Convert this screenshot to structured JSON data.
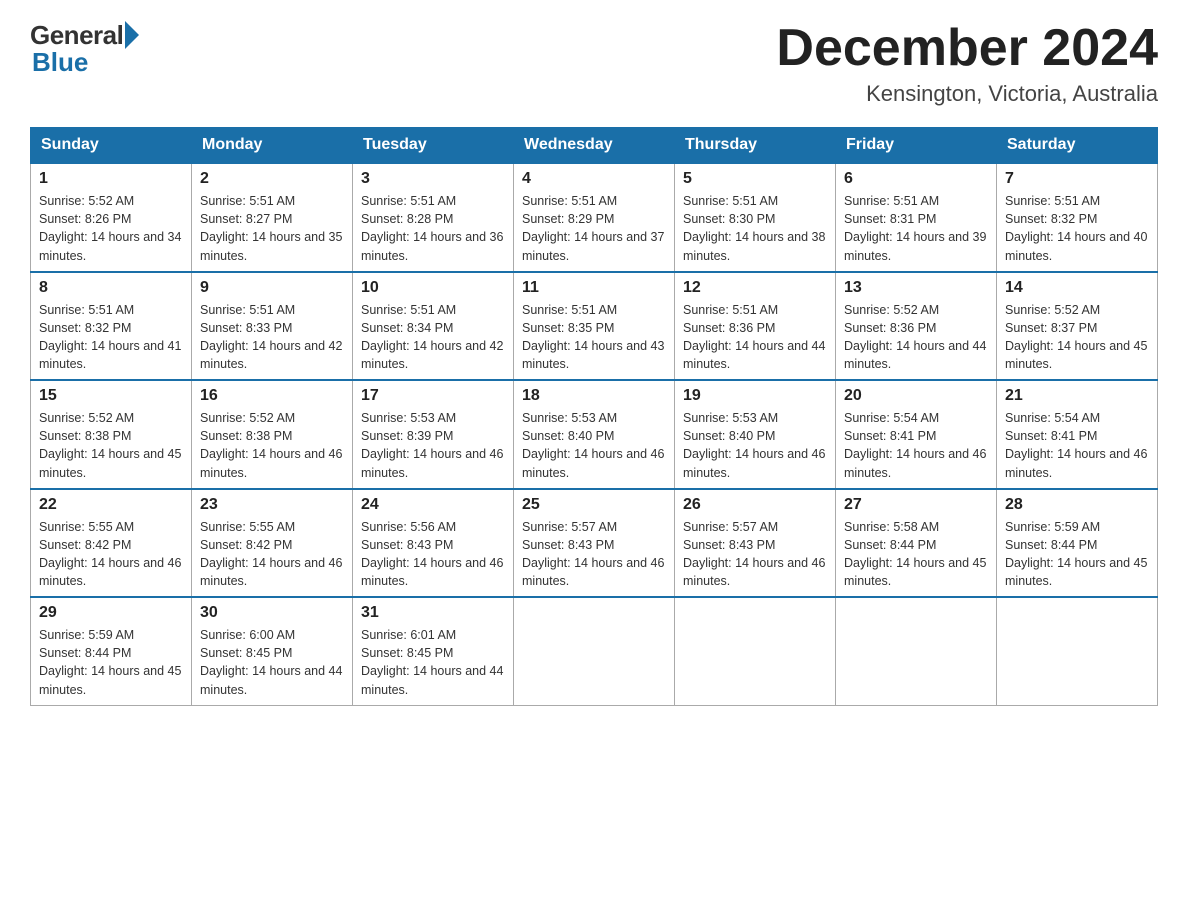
{
  "header": {
    "logo_general": "General",
    "logo_blue": "Blue",
    "month_title": "December 2024",
    "location": "Kensington, Victoria, Australia"
  },
  "days_of_week": [
    "Sunday",
    "Monday",
    "Tuesday",
    "Wednesday",
    "Thursday",
    "Friday",
    "Saturday"
  ],
  "weeks": [
    [
      {
        "day": "1",
        "sunrise": "5:52 AM",
        "sunset": "8:26 PM",
        "daylight": "14 hours and 34 minutes."
      },
      {
        "day": "2",
        "sunrise": "5:51 AM",
        "sunset": "8:27 PM",
        "daylight": "14 hours and 35 minutes."
      },
      {
        "day": "3",
        "sunrise": "5:51 AM",
        "sunset": "8:28 PM",
        "daylight": "14 hours and 36 minutes."
      },
      {
        "day": "4",
        "sunrise": "5:51 AM",
        "sunset": "8:29 PM",
        "daylight": "14 hours and 37 minutes."
      },
      {
        "day": "5",
        "sunrise": "5:51 AM",
        "sunset": "8:30 PM",
        "daylight": "14 hours and 38 minutes."
      },
      {
        "day": "6",
        "sunrise": "5:51 AM",
        "sunset": "8:31 PM",
        "daylight": "14 hours and 39 minutes."
      },
      {
        "day": "7",
        "sunrise": "5:51 AM",
        "sunset": "8:32 PM",
        "daylight": "14 hours and 40 minutes."
      }
    ],
    [
      {
        "day": "8",
        "sunrise": "5:51 AM",
        "sunset": "8:32 PM",
        "daylight": "14 hours and 41 minutes."
      },
      {
        "day": "9",
        "sunrise": "5:51 AM",
        "sunset": "8:33 PM",
        "daylight": "14 hours and 42 minutes."
      },
      {
        "day": "10",
        "sunrise": "5:51 AM",
        "sunset": "8:34 PM",
        "daylight": "14 hours and 42 minutes."
      },
      {
        "day": "11",
        "sunrise": "5:51 AM",
        "sunset": "8:35 PM",
        "daylight": "14 hours and 43 minutes."
      },
      {
        "day": "12",
        "sunrise": "5:51 AM",
        "sunset": "8:36 PM",
        "daylight": "14 hours and 44 minutes."
      },
      {
        "day": "13",
        "sunrise": "5:52 AM",
        "sunset": "8:36 PM",
        "daylight": "14 hours and 44 minutes."
      },
      {
        "day": "14",
        "sunrise": "5:52 AM",
        "sunset": "8:37 PM",
        "daylight": "14 hours and 45 minutes."
      }
    ],
    [
      {
        "day": "15",
        "sunrise": "5:52 AM",
        "sunset": "8:38 PM",
        "daylight": "14 hours and 45 minutes."
      },
      {
        "day": "16",
        "sunrise": "5:52 AM",
        "sunset": "8:38 PM",
        "daylight": "14 hours and 46 minutes."
      },
      {
        "day": "17",
        "sunrise": "5:53 AM",
        "sunset": "8:39 PM",
        "daylight": "14 hours and 46 minutes."
      },
      {
        "day": "18",
        "sunrise": "5:53 AM",
        "sunset": "8:40 PM",
        "daylight": "14 hours and 46 minutes."
      },
      {
        "day": "19",
        "sunrise": "5:53 AM",
        "sunset": "8:40 PM",
        "daylight": "14 hours and 46 minutes."
      },
      {
        "day": "20",
        "sunrise": "5:54 AM",
        "sunset": "8:41 PM",
        "daylight": "14 hours and 46 minutes."
      },
      {
        "day": "21",
        "sunrise": "5:54 AM",
        "sunset": "8:41 PM",
        "daylight": "14 hours and 46 minutes."
      }
    ],
    [
      {
        "day": "22",
        "sunrise": "5:55 AM",
        "sunset": "8:42 PM",
        "daylight": "14 hours and 46 minutes."
      },
      {
        "day": "23",
        "sunrise": "5:55 AM",
        "sunset": "8:42 PM",
        "daylight": "14 hours and 46 minutes."
      },
      {
        "day": "24",
        "sunrise": "5:56 AM",
        "sunset": "8:43 PM",
        "daylight": "14 hours and 46 minutes."
      },
      {
        "day": "25",
        "sunrise": "5:57 AM",
        "sunset": "8:43 PM",
        "daylight": "14 hours and 46 minutes."
      },
      {
        "day": "26",
        "sunrise": "5:57 AM",
        "sunset": "8:43 PM",
        "daylight": "14 hours and 46 minutes."
      },
      {
        "day": "27",
        "sunrise": "5:58 AM",
        "sunset": "8:44 PM",
        "daylight": "14 hours and 45 minutes."
      },
      {
        "day": "28",
        "sunrise": "5:59 AM",
        "sunset": "8:44 PM",
        "daylight": "14 hours and 45 minutes."
      }
    ],
    [
      {
        "day": "29",
        "sunrise": "5:59 AM",
        "sunset": "8:44 PM",
        "daylight": "14 hours and 45 minutes."
      },
      {
        "day": "30",
        "sunrise": "6:00 AM",
        "sunset": "8:45 PM",
        "daylight": "14 hours and 44 minutes."
      },
      {
        "day": "31",
        "sunrise": "6:01 AM",
        "sunset": "8:45 PM",
        "daylight": "14 hours and 44 minutes."
      },
      null,
      null,
      null,
      null
    ]
  ]
}
